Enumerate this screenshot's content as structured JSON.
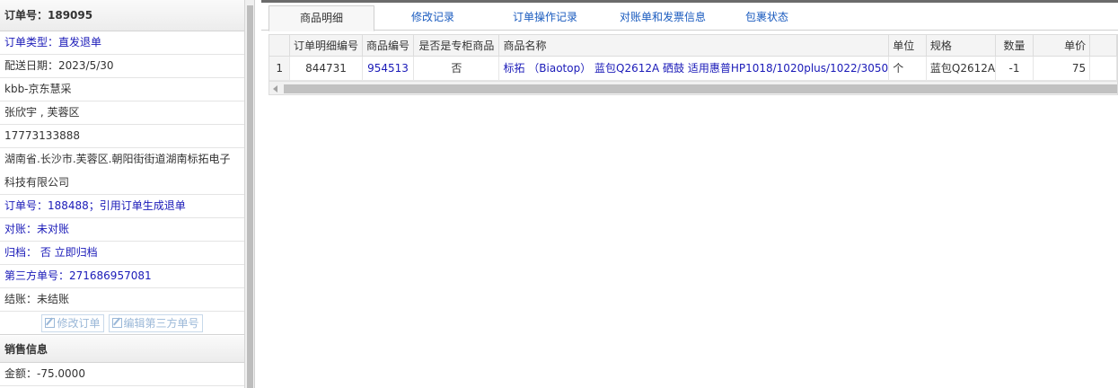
{
  "left_panel": {
    "order_no": "订单号：189095",
    "rows": [
      {
        "text": "订单类型：直发退单",
        "blue": true
      },
      {
        "text": "配送日期：2023/5/30",
        "blue": false
      },
      {
        "text": "kbb-京东慧采",
        "blue": false
      },
      {
        "text": "张欣宇 , 芙蓉区",
        "blue": false
      },
      {
        "text": "17773133888",
        "blue": false
      }
    ],
    "address_line1": "湖南省.长沙市.芙蓉区.朝阳街街道湖南标拓电子",
    "address_line2": "科技有限公司",
    "rows2": [
      {
        "text": "订单号：188488；引用订单生成退单",
        "blue": true
      },
      {
        "text": "对账：未对账",
        "blue": true
      },
      {
        "text": "归档： 否 立即归档",
        "blue": true
      },
      {
        "text": "第三方单号：271686957081",
        "blue": true
      },
      {
        "text": "结账：未结账",
        "blue": false
      }
    ],
    "buttons": {
      "edit_order": "修改订单",
      "edit_third_party": "编辑第三方单号"
    },
    "sales_section_title": "销售信息",
    "amount": "金额：-75.0000"
  },
  "tabs": [
    {
      "label": "商品明细",
      "active": true
    },
    {
      "label": "修改记录",
      "active": false
    },
    {
      "label": "订单操作记录",
      "active": false
    },
    {
      "label": "对账单和发票信息",
      "active": false
    },
    {
      "label": "包裹状态",
      "active": false
    }
  ],
  "grid": {
    "columns": [
      "订单明细编号",
      "商品编号",
      "是否是专柜商品",
      "商品名称",
      "单位",
      "规格",
      "数量",
      "单价"
    ],
    "rows": [
      {
        "row_no": "1",
        "detail_no": "844731",
        "product_no": "954513",
        "is_counter": "否",
        "name": "标拓 （Biaotop） 蓝包Q2612A 硒鼓 适用惠普HP1018/1020plus/1022/3050",
        "unit": "个",
        "spec": "蓝包Q2612A",
        "qty": "-1",
        "price": "75"
      }
    ]
  },
  "colors": {
    "link_blue": "#1a1ab8",
    "tab_blue": "#1a5bbf",
    "button_disabled": "#9bb8d8"
  }
}
